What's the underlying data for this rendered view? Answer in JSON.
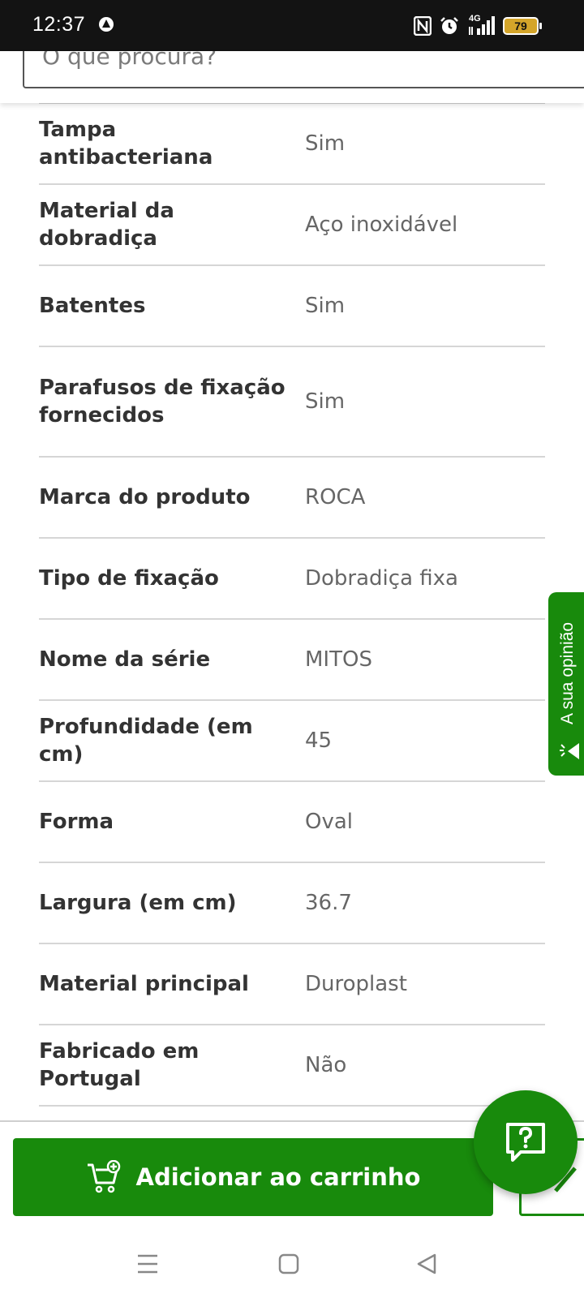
{
  "status_bar": {
    "time": "12:37",
    "network": "4G",
    "battery": "79"
  },
  "search": {
    "placeholder": "O que procura?"
  },
  "specs": [
    {
      "key": "Tampa antibacteriana",
      "value": "Sim"
    },
    {
      "key": "Material da dobradiça",
      "value": "Aço inoxidável"
    },
    {
      "key": "Batentes",
      "value": "Sim"
    },
    {
      "key": "Parafusos de fixação fornecidos",
      "value": "Sim"
    },
    {
      "key": "Marca do produto",
      "value": "ROCA"
    },
    {
      "key": "Tipo de fixação",
      "value": "Dobradiça fixa"
    },
    {
      "key": "Nome da série",
      "value": "MITOS"
    },
    {
      "key": "Profundidade (em cm)",
      "value": "45"
    },
    {
      "key": "Forma",
      "value": "Oval"
    },
    {
      "key": "Largura (em cm)",
      "value": "36.7"
    },
    {
      "key": "Material principal",
      "value": "Duroplast"
    },
    {
      "key": "Fabricado em Portugal",
      "value": "Não"
    }
  ],
  "feedback_tab": {
    "label": "A sua opinião"
  },
  "bottom_bar": {
    "add_to_cart_label": "Adicionar ao carrinho"
  },
  "colors": {
    "brand_green": "#188a0c",
    "status_bar_bg": "#131313"
  },
  "icons": {
    "cart": "cart-plus-icon",
    "help": "question-chat-icon",
    "edit": "pencil-icon"
  }
}
